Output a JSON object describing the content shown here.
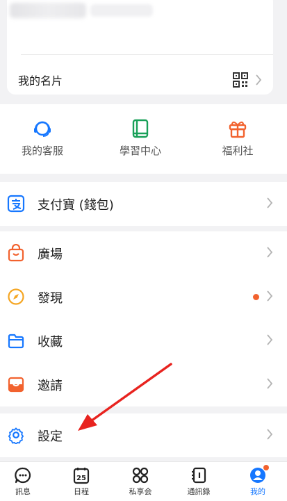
{
  "profile": {
    "namecard_label": "我的名片"
  },
  "quick_actions": [
    {
      "label": "我的客服",
      "icon": "headset-icon",
      "color": "#1677ff"
    },
    {
      "label": "學習中心",
      "icon": "book-icon",
      "color": "#18a058"
    },
    {
      "label": "福利社",
      "icon": "gift-icon",
      "color": "#f2622e"
    }
  ],
  "menu": {
    "alipay": "支付寶 (錢包)",
    "plaza": "廣場",
    "discover": "發現",
    "favorites": "收藏",
    "invite": "邀請",
    "settings": "設定"
  },
  "nav": {
    "messages": "訊息",
    "calendar": "日程",
    "calendar_day": "25",
    "private": "私享会",
    "contacts": "通訊錄",
    "me": "我的"
  },
  "colors": {
    "accent": "#1677ff",
    "orange": "#f2622e",
    "green": "#18a058",
    "yellow": "#f5a623"
  }
}
